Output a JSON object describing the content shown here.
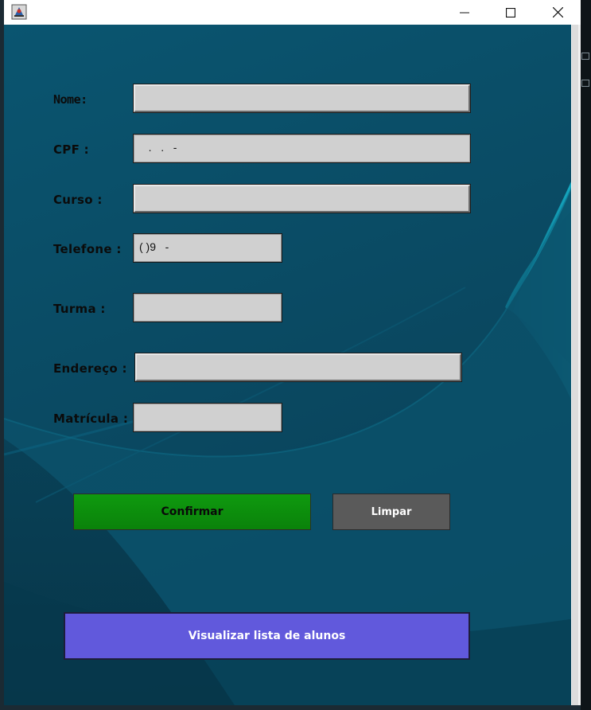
{
  "window": {
    "icon": "java-app-icon",
    "controls": {
      "minimize": "minimize-icon",
      "maximize": "maximize-icon",
      "close": "close-icon"
    }
  },
  "form": {
    "nome_label": "Nome:",
    "cpf_label": "CPF :",
    "cpf_value": "   .   .   -",
    "curso_label": "Curso :",
    "telefone_label": "Telefone :",
    "telefone_value": "( )9   -",
    "turma_label": "Turma :",
    "endereco_label": "Endereço :",
    "matricula_label": "Matrícula :"
  },
  "buttons": {
    "confirmar": "Confirmar",
    "limpar": "Limpar",
    "visualizar": "Visualizar lista de alunos"
  },
  "colors": {
    "background": "#0d4b63",
    "confirm": "#0a8f0a",
    "limpar": "#5a5a5a",
    "visualizar": "#6159dc",
    "field": "#d0d0d0"
  }
}
